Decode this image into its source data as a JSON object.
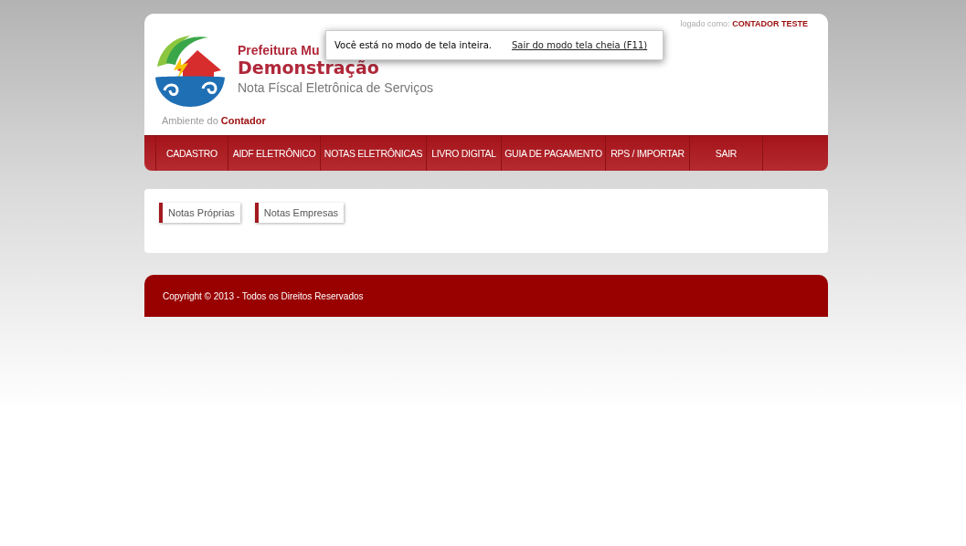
{
  "header": {
    "title_visible": "Prefeitura Mu",
    "city": "Demonstração",
    "subtitle": "Nota Físcal Eletrônica de Serviços",
    "environment_label": "Ambiente do",
    "environment_role": "Contador",
    "logged_label": "logado como:",
    "logged_user": "CONTADOR TESTE"
  },
  "fullscreen_notice": {
    "message": "Você está no modo de tela inteira.",
    "exit_link": "Sair do modo tela cheia (F11)"
  },
  "nav": [
    {
      "label": "CADASTRO"
    },
    {
      "label": "AIDF ELETRÔNICO"
    },
    {
      "label": "NOTAS ELETRÔNICAS"
    },
    {
      "label": "LIVRO DIGITAL"
    },
    {
      "label": "GUIA DE PAGAMENTO"
    },
    {
      "label": "RPS / IMPORTAR"
    },
    {
      "label": "SAIR"
    }
  ],
  "buttons": [
    {
      "label": "Notas Próprias"
    },
    {
      "label": "Notas Empresas"
    }
  ],
  "footer": {
    "copyright": "Copyright © 2013 - Todos os Direitos Reservados"
  }
}
